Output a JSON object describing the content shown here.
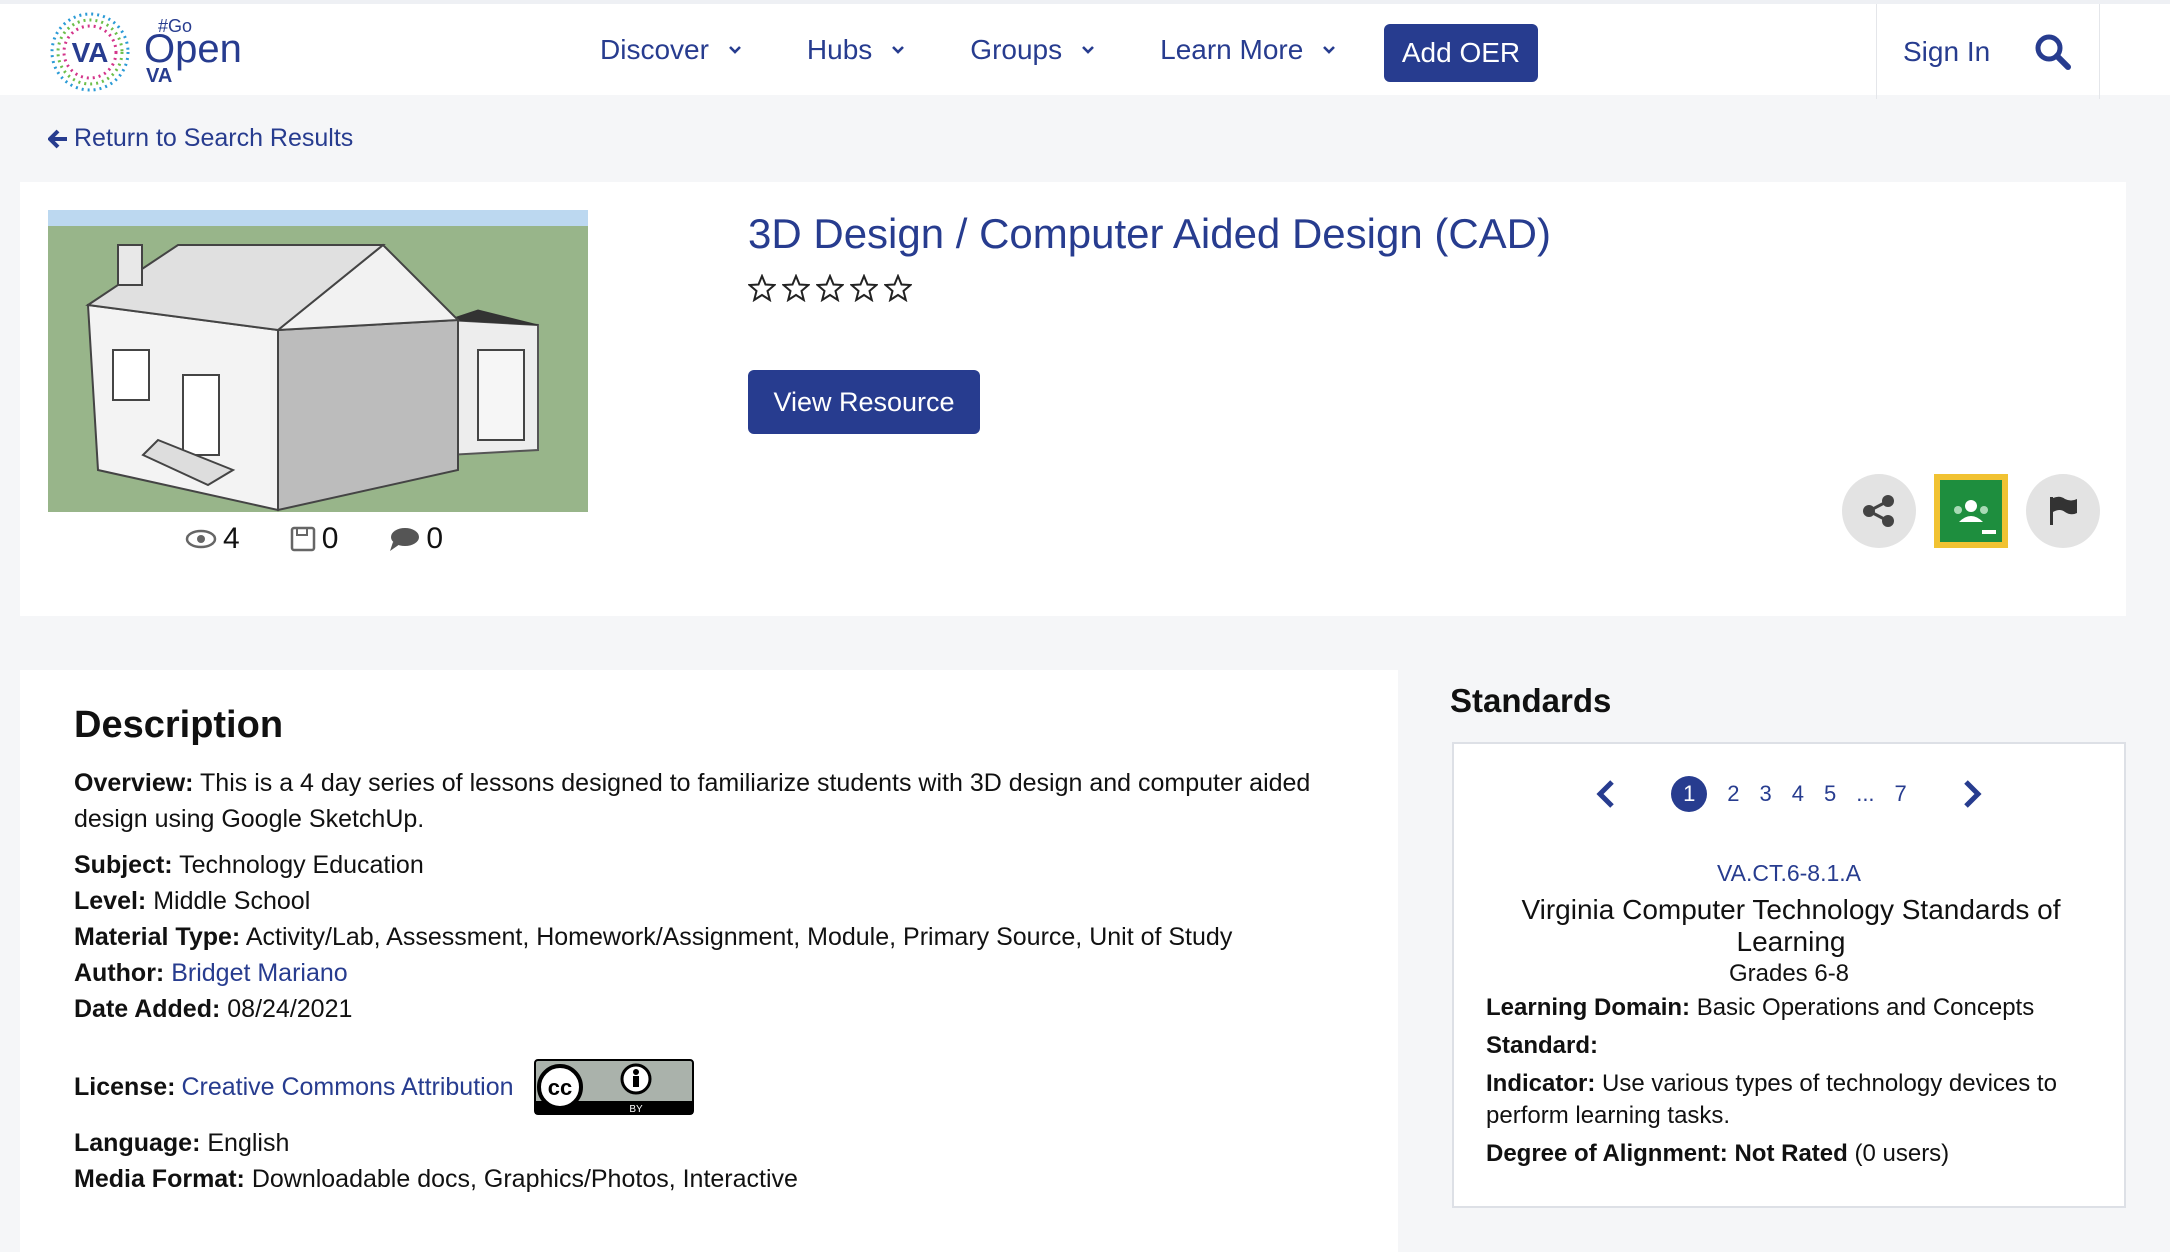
{
  "header": {
    "logo": {
      "va": "VA",
      "go": "#Go",
      "open": "Open",
      "va2": "VA"
    },
    "nav": [
      {
        "label": "Discover"
      },
      {
        "label": "Hubs"
      },
      {
        "label": "Groups"
      },
      {
        "label": "Learn More"
      }
    ],
    "add_label": "Add OER",
    "signin_label": "Sign In",
    "icons": {
      "search": "search-icon",
      "chevron": "chevron-down-icon"
    }
  },
  "back_label": "Return to Search Results",
  "resource": {
    "title": "3D Design / Computer Aided Design (CAD)",
    "rating": 0,
    "rating_max": 5,
    "view_label": "View Resource",
    "stats": {
      "views": "4",
      "saves": "0",
      "comments": "0"
    }
  },
  "description": {
    "heading": "Description",
    "overview_label": "Overview:",
    "overview": "This is a 4 day series of lessons designed to familiarize students with 3D design and computer aided design using Google SketchUp.",
    "subject_label": "Subject:",
    "subject": "Technology Education",
    "level_label": "Level:",
    "level": "Middle School",
    "material_label": "Material Type:",
    "material": "Activity/Lab, Assessment, Homework/Assignment, Module, Primary Source, Unit of Study",
    "author_label": "Author:",
    "author": "Bridget Mariano",
    "date_label": "Date Added:",
    "date": "08/24/2021",
    "license_label": "License:",
    "license": "Creative Commons Attribution",
    "license_badge": {
      "cc": "cc",
      "by": "BY"
    },
    "language_label": "Language:",
    "language": "English",
    "media_label": "Media Format:",
    "media": "Downloadable docs, Graphics/Photos, Interactive"
  },
  "standards": {
    "heading": "Standards",
    "pages": [
      "1",
      "2",
      "3",
      "4",
      "5",
      "...",
      "7"
    ],
    "active_page": "1",
    "code": "VA.CT.6-8.1.A",
    "name": "Virginia Computer Technology Standards of Learning",
    "grades": "Grades 6-8",
    "domain_label": "Learning Domain:",
    "domain": "Basic Operations and Concepts",
    "standard_label": "Standard:",
    "indicator_label": "Indicator:",
    "indicator": "Use various types of technology devices to perform learning tasks.",
    "alignment_label": "Degree of Alignment:",
    "alignment": "Not Rated",
    "alignment_users": "(0 users)"
  },
  "colors": {
    "brand": "#273c8f",
    "classroom_green": "#1e8e3e",
    "classroom_border": "#f1c232"
  }
}
